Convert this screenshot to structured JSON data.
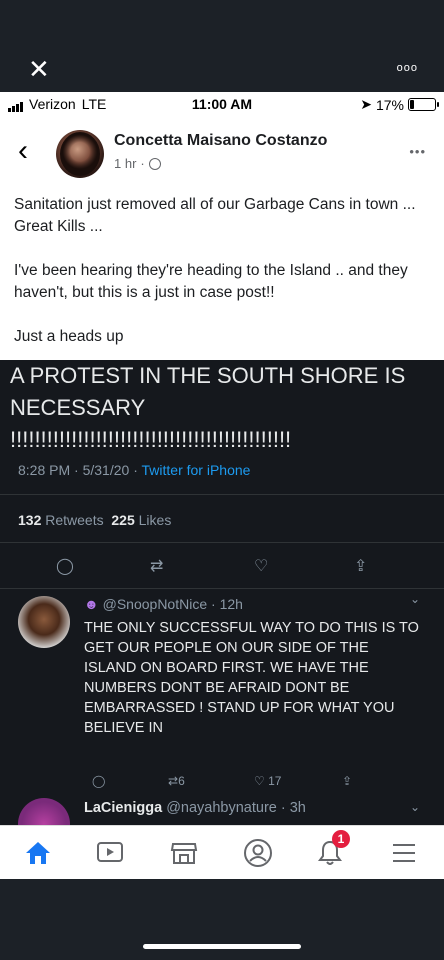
{
  "viewer": {
    "close_icon": "close-icon",
    "more_label": "ooo"
  },
  "status_bar": {
    "carrier": "Verizon",
    "network": "LTE",
    "time": "11:00 AM",
    "battery": "17%",
    "battery_level": 0.17
  },
  "post": {
    "author": "Concetta Maisano Costanzo",
    "time": "1 hr",
    "separator": "·",
    "more": "•••",
    "paragraphs": [
      "Sanitation just removed all of our Garbage Cans in town ... Great Kills ...",
      "I've been hearing they're heading to the Island .. and they haven't, but this is a just in case post!!",
      "Just a heads up"
    ]
  },
  "tweet": {
    "text": "A PROTEST IN THE SOUTH SHORE IS NECESSARY !!!!!!!!!!!!!!!!!!!!!!!!!!!!!!!!!!!!!!!!!!!!!!",
    "time": "8:28 PM",
    "date": "5/31/20",
    "source": "Twitter for iPhone",
    "retweets_count": "132",
    "retweets_label": "Retweets",
    "likes_count": "225",
    "likes_label": "Likes"
  },
  "reply": {
    "handle": "@SnoopNotNice",
    "age": "12h",
    "text": "THE ONLY SUCCESSFUL WAY TO DO THIS IS TO GET OUR PEOPLE ON OUR SIDE OF THE ISLAND ON BOARD FIRST. WE HAVE THE NUMBERS DONT BE AFRAID DONT BE EMBARRASSED ! STAND UP FOR WHAT YOU BELIEVE IN",
    "retweets": "6",
    "likes": "17"
  },
  "reply2": {
    "name": "LaCienigga",
    "handle": "@nayahbynature",
    "age": "3h"
  },
  "nav": {
    "notifications_badge": "1",
    "colors": {
      "active": "#1877f2",
      "inactive": "#65676b"
    }
  }
}
